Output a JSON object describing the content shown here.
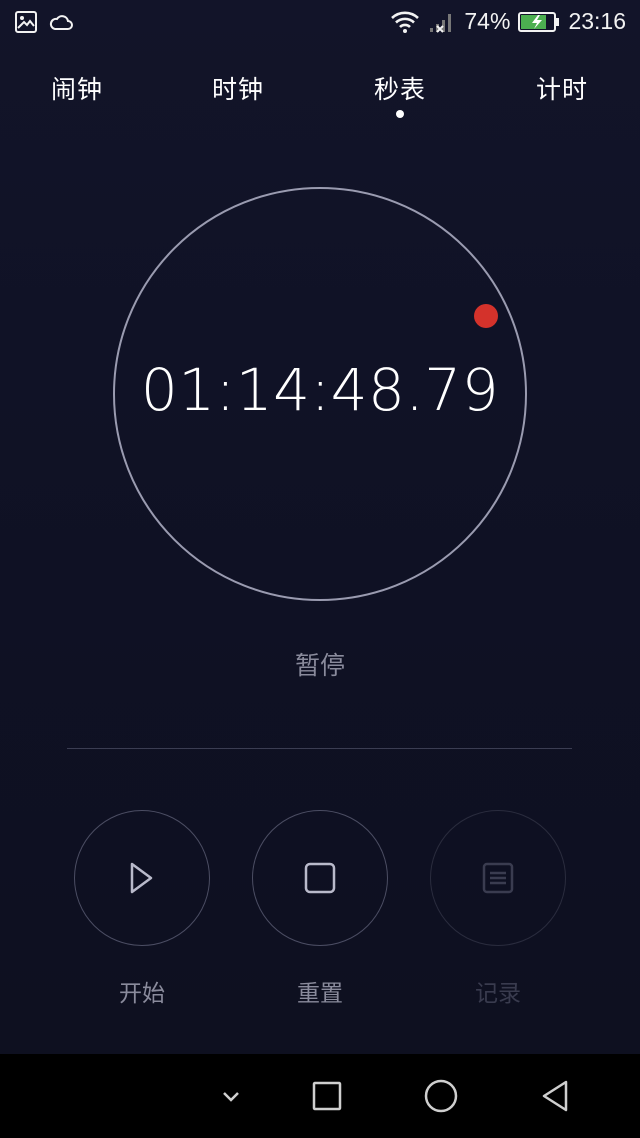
{
  "status_bar": {
    "left_icons": [
      "gallery-icon",
      "cloud-icon"
    ],
    "right_icons": [
      "wifi-icon",
      "signal-no-service-icon",
      "battery-charging-icon"
    ],
    "battery_percent": "74%",
    "time": "23:16"
  },
  "tabs": [
    {
      "label": "闹钟",
      "active": false
    },
    {
      "label": "时钟",
      "active": false
    },
    {
      "label": "秒表",
      "active": true
    },
    {
      "label": "计时",
      "active": false
    }
  ],
  "stopwatch": {
    "elapsed": "01:14:48.79",
    "state_label": "暂停",
    "marker_color": "#d4322b"
  },
  "controls": [
    {
      "label": "开始",
      "icon": "play-icon",
      "enabled": true
    },
    {
      "label": "重置",
      "icon": "stop-icon",
      "enabled": true
    },
    {
      "label": "记录",
      "icon": "lap-list-icon",
      "enabled": false
    }
  ],
  "nav_bar": {
    "buttons": [
      "hide-nav-icon",
      "recents-icon",
      "home-icon",
      "back-icon"
    ]
  }
}
